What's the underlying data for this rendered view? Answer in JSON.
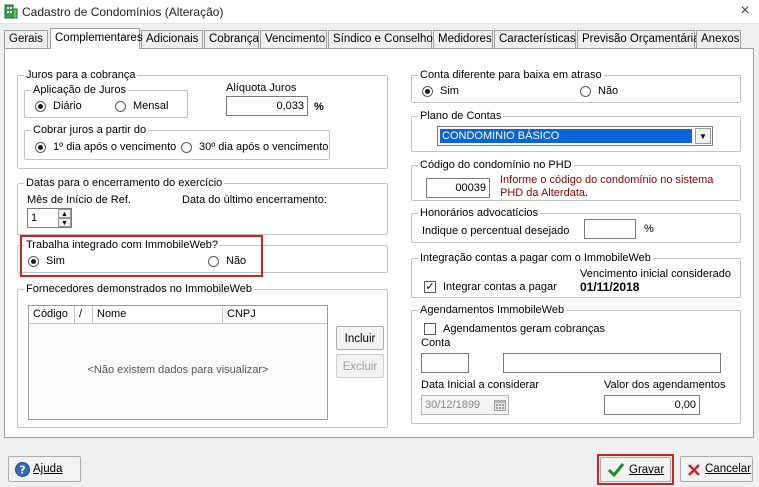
{
  "window": {
    "title": "Cadastro de Condomínios (Alteração)",
    "close_glyph": "×"
  },
  "tabs": [
    {
      "label": "Gerais"
    },
    {
      "label": "Complementares"
    },
    {
      "label": "Adicionais"
    },
    {
      "label": "Cobrança"
    },
    {
      "label": "Vencimento"
    },
    {
      "label": "Síndico e Conselho"
    },
    {
      "label": "Medidores"
    },
    {
      "label": "Características"
    },
    {
      "label": "Previsão Orçamentária"
    },
    {
      "label": "Anexos"
    }
  ],
  "active_tab": "Complementares",
  "juros": {
    "group_label": "Juros para a cobrança",
    "aplicacao_label": "Aplicação de Juros",
    "diario": "Diário",
    "mensal": "Mensal",
    "selected": "Diário",
    "aliquota_label": "Alíquota Juros",
    "aliquota_value": "0,033",
    "percent": "%",
    "cobrar_label": "Cobrar juros a partir do",
    "opt1": "1º dia após o vencimento",
    "opt2": "30º dia após o vencimento",
    "cobrar_selected": "1º dia após o vencimento"
  },
  "encerramento": {
    "group_label": "Datas para o encerramento do exercício",
    "mes_label": "Mês de Início de Ref.",
    "mes_value": "1",
    "ultimo_label": "Data do último encerramento:",
    "spin_up": "▲",
    "spin_down": "▼"
  },
  "immobile": {
    "group_label": "Trabalha integrado com ImmobileWeb?",
    "sim": "Sim",
    "nao": "Não",
    "selected": "Sim"
  },
  "fornecedores": {
    "group_label": "Fornecedores demonstrados no ImmobileWeb",
    "columns": [
      "Código",
      "/",
      "Nome",
      "CNPJ"
    ],
    "empty_text": "<Não existem dados para visualizar>",
    "incluir": "Incluir",
    "excluir": "Excluir"
  },
  "conta_baixa": {
    "group_label": "Conta diferente para baixa em atraso",
    "sim": "Sim",
    "nao": "Não",
    "selected": "Sim"
  },
  "plano": {
    "group_label": "Plano de Contas",
    "value": "CONDOMINIO BÁSICO",
    "arrow": "▼"
  },
  "phd": {
    "group_label": "Código do condomínio no PHD",
    "value": "00039",
    "hint": "Informe o código do condomínio no sistema PHD da Alterdata."
  },
  "honorarios": {
    "group_label": "Honorários advocatícios",
    "label": "Indique o percentual desejado",
    "value": "",
    "percent": "%"
  },
  "integracao": {
    "group_label": "Integração contas a pagar com o ImmobileWeb",
    "check_label": "Integrar contas a pagar",
    "checked": true,
    "check_glyph": "✓",
    "venc_label": "Vencimento inicial considerado",
    "venc_value": "01/11/2018"
  },
  "agendamentos": {
    "group_label": "Agendamentos ImmobileWeb",
    "check_label": "Agendamentos geram cobranças",
    "checked": false,
    "conta_label": "Conta",
    "conta_code": "",
    "conta_desc": "",
    "data_label": "Data Inicial a considerar",
    "data_value": "30/12/1899",
    "valor_label": "Valor dos agendamentos",
    "valor_value": "0,00"
  },
  "footer": {
    "ajuda": "Ajuda",
    "gravar": "Gravar",
    "cancelar": "Cancelar"
  },
  "colors": {
    "highlight_red": "#d22121",
    "selection_blue": "#0a64d6",
    "hint_text": "#8b0000"
  }
}
